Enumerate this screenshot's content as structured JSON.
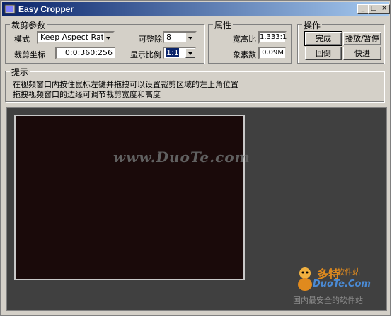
{
  "window": {
    "title": "Easy Cropper",
    "minimize": "_",
    "maximize": "□",
    "close": "×"
  },
  "crop_params": {
    "group_label": "裁剪参数",
    "mode_label": "模式",
    "mode_value": "Keep Aspect Ratio",
    "divisible_label": "可整除",
    "divisible_value": "8",
    "coords_label": "裁剪坐标",
    "coords_value": "0:0:360:256",
    "display_ratio_label": "显示比例",
    "display_ratio_value": "1:1"
  },
  "properties": {
    "group_label": "属性",
    "aspect_label": "宽高比",
    "aspect_value": "1.333:1",
    "pixels_label": "象素数",
    "pixels_value": "0.09M"
  },
  "actions": {
    "group_label": "操作",
    "done": "完成",
    "play_pause": "播放/暂停",
    "rewind": "回倒",
    "fast_forward": "快进"
  },
  "hints": {
    "group_label": "提示",
    "line1": "在视频窗口内按住鼠标左键并拖拽可以设置裁剪区域的左上角位置",
    "line2": "拖拽视频窗口的边缘可调节裁剪宽度和高度"
  },
  "watermarks": {
    "center": "www.DuoTe.com",
    "logo_cn": "多特",
    "logo_cn_small": "软件站",
    "logo_domain": "DuoTe.Com",
    "logo_slogan": "国内最安全的软件站"
  }
}
